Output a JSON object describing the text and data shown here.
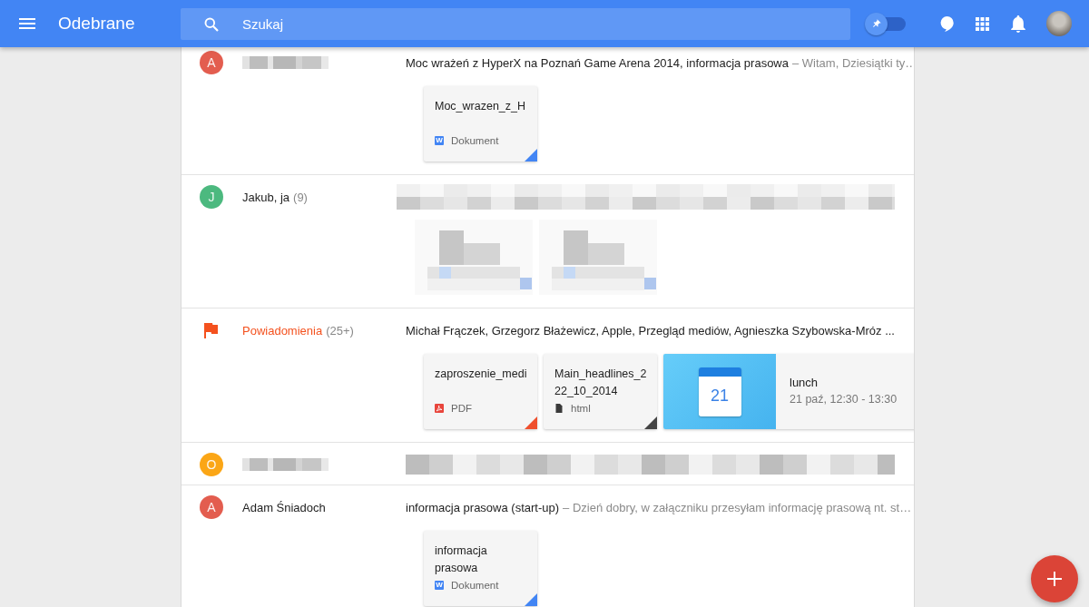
{
  "top_bar": {
    "title": "Odebrane",
    "search": {
      "placeholder": "Szukaj"
    },
    "pin_toggle": {
      "on": false
    }
  },
  "threads": [
    {
      "kind": "person",
      "avatar": {
        "letter": "A",
        "color": "#e35d4f"
      },
      "sender_pixelated": true,
      "subject_pixelated": false,
      "subject": "Moc wrażeń z HyperX na Poznań Game Arena 2014, informacja prasowa",
      "snippet": "– Witam, Dziesiątki ty…",
      "attachments": [
        {
          "kind": "doc",
          "name": "Moc_wrazen_z_H",
          "type_icon": "W",
          "type_label": "Dokument"
        }
      ]
    },
    {
      "kind": "person",
      "avatar": {
        "letter": "J",
        "color": "#4cb97f"
      },
      "sender_pixelated": false,
      "sender": "Jakub, ja",
      "count": "(9)",
      "subject_pixelated": true,
      "attachments": [
        {
          "kind": "pixelated"
        },
        {
          "kind": "pixelated"
        }
      ]
    },
    {
      "kind": "bundle",
      "color": "#f4511e",
      "sender_pixelated": false,
      "sender": "Powiadomienia",
      "count": "(25+)",
      "subject_pixelated": false,
      "subject": "Michał Frączek, Grzegorz Błażewicz, Apple, Przegląd mediów, Agnieszka Szybowska-Mróz ...",
      "attachments": [
        {
          "kind": "pdf",
          "name": "zaproszenie_medi",
          "type_label": "PDF"
        },
        {
          "kind": "html",
          "name": "Main_headlines_2\n22_10_2014",
          "type_label": "html"
        },
        {
          "kind": "event",
          "calendar_day": "21",
          "title": "lunch",
          "time": "21 paź, 12:30 - 13:30"
        }
      ]
    },
    {
      "kind": "person",
      "avatar": {
        "letter": "O",
        "color": "#fba616"
      },
      "sender_pixelated": true,
      "subject_pixelated": true
    },
    {
      "kind": "person",
      "avatar": {
        "letter": "A",
        "color": "#e35d4f"
      },
      "sender_pixelated": false,
      "sender": "Adam Śniadoch",
      "subject_pixelated": false,
      "subject": "informacja prasowa (start-up)",
      "snippet": "– Dzień dobry, w załączniku przesyłam informację prasową nt. st…",
      "attachments": [
        {
          "kind": "doc",
          "name": "informacja prasowa",
          "type_icon": "W",
          "type_label": "Dokument"
        }
      ]
    }
  ]
}
